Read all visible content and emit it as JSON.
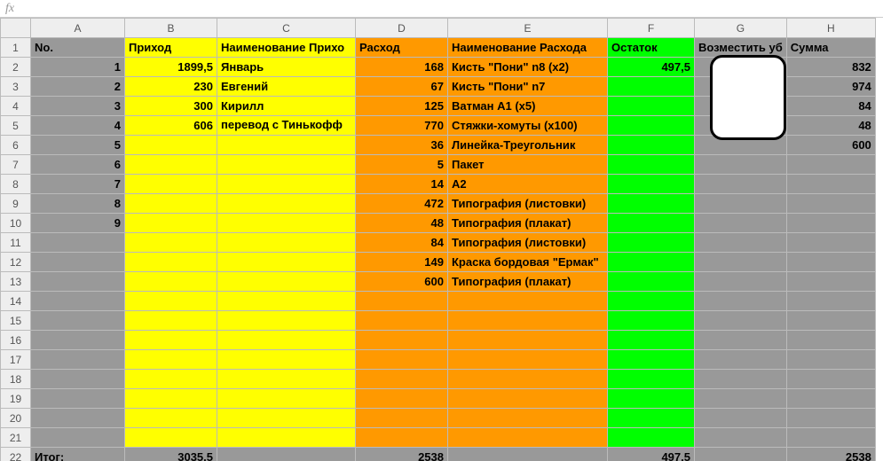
{
  "fx_label": "fx",
  "col_letters": [
    "A",
    "B",
    "C",
    "D",
    "E",
    "F",
    "G",
    "H"
  ],
  "headers": {
    "A": "No.",
    "B": "Приход",
    "C": "Наименование Прихода",
    "C_display": "Наименование Прихо",
    "D": "Расход",
    "E": "Наименование Расхода",
    "F": "Остаток",
    "G": "Возместить убытки",
    "G_display": "Возместить уб",
    "H": "Сумма"
  },
  "rows": [
    {
      "A": "1",
      "B": "1899,5",
      "C": "Январь",
      "D": "168",
      "E": "Кисть \"Пони\" n8 (x2)",
      "F": "497,5",
      "H": "832"
    },
    {
      "A": "2",
      "B": "230",
      "C": "Евгений",
      "D": "67",
      "E": "Кисть \"Пони\" n7",
      "H": "974"
    },
    {
      "A": "3",
      "B": "300",
      "C": "Кирилл",
      "D": "125",
      "E": "Ватман А1 (x5)",
      "H": "84"
    },
    {
      "A": "4",
      "B": "606",
      "C": "перевод с Тинькофф",
      "D": "770",
      "E": "Стяжки-хомуты (x100)",
      "H": "48"
    },
    {
      "A": "5",
      "D": "36",
      "E": "Линейка-Треугольник",
      "H": "600"
    },
    {
      "A": "6",
      "D": "5",
      "E": "Пакет"
    },
    {
      "A": "7",
      "D": "14",
      "E": "А2"
    },
    {
      "A": "8",
      "D": "472",
      "E": "Типография (листовки)"
    },
    {
      "A": "9",
      "D": "48",
      "E": "Типография (плакат)"
    },
    {
      "D": "84",
      "E": "Типография (листовки)"
    },
    {
      "D": "149",
      "E": "Краска бордовая \"Ермак\""
    },
    {
      "D": "600",
      "E": "Типография (плакат)"
    },
    {},
    {},
    {},
    {},
    {},
    {},
    {},
    {}
  ],
  "totals": {
    "A": "Итог:",
    "B": "3035,5",
    "D": "2538",
    "F": "497,5",
    "H": "2538"
  },
  "chart_data": {
    "type": "table",
    "title": "Финансовый отчёт",
    "columns": [
      "No.",
      "Приход",
      "Наименование Прихода",
      "Расход",
      "Наименование Расхода",
      "Остаток",
      "Возместить убытки",
      "Сумма"
    ],
    "data": [
      [
        1,
        1899.5,
        "Январь",
        168,
        "Кисть \"Пони\" n8 (x2)",
        497.5,
        null,
        832
      ],
      [
        2,
        230,
        "Евгений",
        67,
        "Кисть \"Пони\" n7",
        null,
        null,
        974
      ],
      [
        3,
        300,
        "Кирилл",
        125,
        "Ватман А1 (x5)",
        null,
        null,
        84
      ],
      [
        4,
        606,
        "перевод с Тинькофф",
        770,
        "Стяжки-хомуты (x100)",
        null,
        null,
        48
      ],
      [
        5,
        null,
        null,
        36,
        "Линейка-Треугольник",
        null,
        null,
        600
      ],
      [
        6,
        null,
        null,
        5,
        "Пакет",
        null,
        null,
        null
      ],
      [
        7,
        null,
        null,
        14,
        "А2",
        null,
        null,
        null
      ],
      [
        8,
        null,
        null,
        472,
        "Типография (листовки)",
        null,
        null,
        null
      ],
      [
        9,
        null,
        null,
        48,
        "Типография (плакат)",
        null,
        null,
        null
      ],
      [
        null,
        null,
        null,
        84,
        "Типография (листовки)",
        null,
        null,
        null
      ],
      [
        null,
        null,
        null,
        149,
        "Краска бордовая \"Ермак\"",
        null,
        null,
        null
      ],
      [
        null,
        null,
        null,
        600,
        "Типография (плакат)",
        null,
        null,
        null
      ]
    ],
    "totals": {
      "Приход": 3035.5,
      "Расход": 2538,
      "Остаток": 497.5,
      "Сумма": 2538
    }
  }
}
